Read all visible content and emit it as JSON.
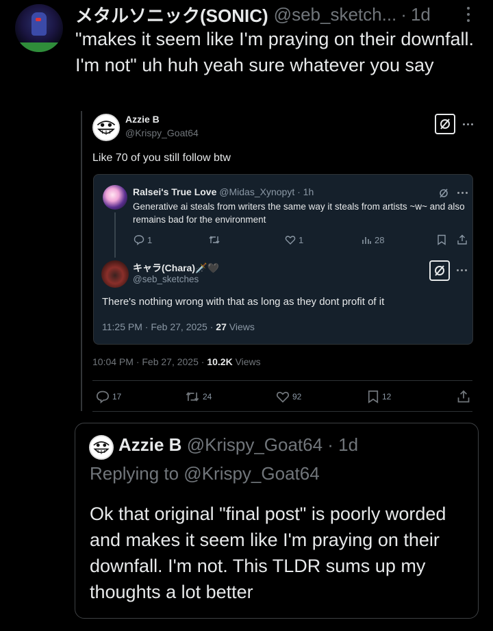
{
  "top_post": {
    "display_name": "メタルソニック(SONIC)",
    "handle": "@seb_sketch...",
    "separator": "·",
    "time": "1d",
    "text": "\"makes it seem like I'm praying on their downfall. I'm not\"  uh huh yeah sure whatever you say"
  },
  "embedded_post": {
    "display_name": "Azzie B",
    "handle": "@Krispy_Goat64",
    "text": "Like 70 of you still follow btw",
    "meta_time": "10:04 PM · Feb 27, 2025 · ",
    "views_count": "10.2K",
    "views_label": " Views",
    "actions": {
      "replies": "17",
      "reposts": "24",
      "likes": "92",
      "bookmarks": "12"
    },
    "quoted": {
      "original": {
        "display_name": "Ralsei's True Love",
        "handle": "@Midas_Xynopyt · 1h",
        "text": "Generative ai steals from writers the same way it steals from artists ~w~ and also remains bad for the environment",
        "actions": {
          "replies": "1",
          "likes": "1",
          "views": "28"
        }
      },
      "reply": {
        "display_name": "キャラ(Chara)🗡️🖤",
        "handle": "@seb_sketches",
        "text": "There's nothing wrong with that as long as they dont profit of it",
        "meta_time": "11:25 PM · Feb 27, 2025 · ",
        "views_count": "27",
        "views_label": " Views"
      }
    }
  },
  "quote_card": {
    "display_name": "Azzie B",
    "handle": "@Krispy_Goat64 · 1d",
    "replying_to": "Replying to @Krispy_Goat64",
    "text": "Ok that original \"final post\" is poorly worded and makes it seem like I'm praying on their downfall. I'm not. This TLDR sums up my thoughts a lot better"
  },
  "icons": [
    "more-icon",
    "grok-icon",
    "reply-icon",
    "repost-icon",
    "like-icon",
    "views-icon",
    "bookmark-icon",
    "share-icon"
  ]
}
